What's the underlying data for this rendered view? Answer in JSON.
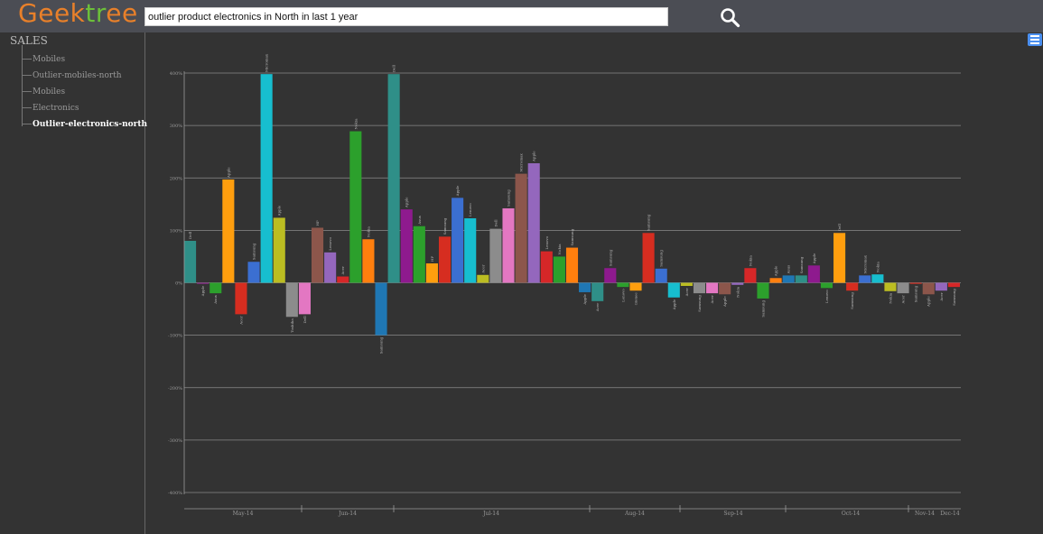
{
  "app": {
    "logo_letters": [
      {
        "ch": "G",
        "color": "#e8802a"
      },
      {
        "ch": "e",
        "color": "#e8802a"
      },
      {
        "ch": "e",
        "color": "#e8802a"
      },
      {
        "ch": "k",
        "color": "#e8802a"
      },
      {
        "ch": "t",
        "color": "#6cbf3a"
      },
      {
        "ch": "r",
        "color": "#6cbf3a"
      },
      {
        "ch": "e",
        "color": "#e8802a"
      },
      {
        "ch": "e",
        "color": "#e8802a"
      }
    ]
  },
  "search": {
    "query": "outlier product electronics in North in last 1 year",
    "button_icon": "search-icon"
  },
  "sidebar": {
    "title": "SALES",
    "items": [
      {
        "label": "Mobiles",
        "active": false
      },
      {
        "label": "Outlier-mobiles-north",
        "active": false
      },
      {
        "label": "Mobiles",
        "active": false
      },
      {
        "label": "Electronics",
        "active": false
      },
      {
        "label": "Outlier-electronics-north",
        "active": true
      }
    ]
  },
  "menu_icon": "hamburger-menu-icon",
  "chart_data": {
    "type": "bar",
    "ylim": [
      -400,
      400
    ],
    "yticks": [
      {
        "value": 400,
        "label": "400%"
      },
      {
        "value": 300,
        "label": "300%"
      },
      {
        "value": 200,
        "label": "200%"
      },
      {
        "value": 100,
        "label": "100%"
      },
      {
        "value": 0,
        "label": "0%"
      },
      {
        "value": -100,
        "label": "-100%"
      },
      {
        "value": -200,
        "label": "-200%"
      },
      {
        "value": -300,
        "label": "-300%"
      },
      {
        "value": -400,
        "label": "-400%"
      }
    ],
    "months": [
      "May-14",
      "Jun-14",
      "Jul-14",
      "Aug-14",
      "Sep-14",
      "Oct-14",
      "Nov-14",
      "Dec-14"
    ],
    "bars": [
      {
        "label": "Dell",
        "value": 80,
        "color": "#2f8f88"
      },
      {
        "label": "Apple",
        "value": -2,
        "color": "#8e2a8e"
      },
      {
        "label": "Asus",
        "value": -20,
        "color": "#2ca02c"
      },
      {
        "label": "Apple",
        "value": 197,
        "color": "#ff9e0e"
      },
      {
        "label": "Acer",
        "value": -60,
        "color": "#d62d20"
      },
      {
        "label": "Samsung",
        "value": 40,
        "color": "#3b6fd1"
      },
      {
        "label": "Micromax",
        "value": 398,
        "color": "#17becf"
      },
      {
        "label": "Apple",
        "value": 124,
        "color": "#bcbd22"
      },
      {
        "label": "Toshiba",
        "value": -65,
        "color": "#8c8c8c"
      },
      {
        "label": "Dell",
        "value": -60,
        "color": "#e377c2"
      },
      {
        "label": "HP",
        "value": 105,
        "color": "#8c564b"
      },
      {
        "label": "Lenovo",
        "value": 58,
        "color": "#9467bd"
      },
      {
        "label": "Acer",
        "value": 12,
        "color": "#d62728"
      },
      {
        "label": "Nokia",
        "value": 289,
        "color": "#2ca02c"
      },
      {
        "label": "Nokia",
        "value": 83,
        "color": "#ff7f0e"
      },
      {
        "label": "Samsung",
        "value": -100,
        "color": "#1f77b4"
      },
      {
        "label": "Dell",
        "value": 398,
        "color": "#2f8f88"
      },
      {
        "label": "Apple",
        "value": 140,
        "color": "#8e1a8e"
      },
      {
        "label": "Asus",
        "value": 108,
        "color": "#2ca02c"
      },
      {
        "label": "HP",
        "value": 37,
        "color": "#ff9e0e"
      },
      {
        "label": "Samsung",
        "value": 88,
        "color": "#d62d20"
      },
      {
        "label": "Apple",
        "value": 162,
        "color": "#3b6fd1"
      },
      {
        "label": "Lenovo",
        "value": 123,
        "color": "#17becf"
      },
      {
        "label": "Acer",
        "value": 15,
        "color": "#bcbd22"
      },
      {
        "label": "Dell",
        "value": 103,
        "color": "#8c8c8c"
      },
      {
        "label": "Samsung",
        "value": 142,
        "color": "#e377c2"
      },
      {
        "label": "Micromax",
        "value": 208,
        "color": "#8c564b"
      },
      {
        "label": "Apple",
        "value": 228,
        "color": "#9467bd"
      },
      {
        "label": "Lenovo",
        "value": 60,
        "color": "#d62728"
      },
      {
        "label": "Nokia",
        "value": 50,
        "color": "#2ca02c"
      },
      {
        "label": "Samsung",
        "value": 67,
        "color": "#ff7f0e"
      },
      {
        "label": "Apple",
        "value": -18,
        "color": "#1f77b4"
      },
      {
        "label": "Acer",
        "value": -35,
        "color": "#2f8f88"
      },
      {
        "label": "Samsung",
        "value": 28,
        "color": "#8e1a8e"
      },
      {
        "label": "Lenovo",
        "value": -8,
        "color": "#2ca02c"
      },
      {
        "label": "Gionee",
        "value": -15,
        "color": "#ff9e0e"
      },
      {
        "label": "Samsung",
        "value": 95,
        "color": "#d62d20"
      },
      {
        "label": "Samsung",
        "value": 27,
        "color": "#3b6fd1"
      },
      {
        "label": "Apple",
        "value": -28,
        "color": "#17becf"
      },
      {
        "label": "Acer",
        "value": -6,
        "color": "#bcbd22"
      },
      {
        "label": "Samsung",
        "value": -20,
        "color": "#8c8c8c"
      },
      {
        "label": "Acer",
        "value": -20,
        "color": "#e377c2"
      },
      {
        "label": "Apple",
        "value": -22,
        "color": "#8c564b"
      },
      {
        "label": "Nokia",
        "value": -4,
        "color": "#9467bd"
      },
      {
        "label": "Nokia",
        "value": 28,
        "color": "#d62728"
      },
      {
        "label": "Samsung",
        "value": -30,
        "color": "#2ca02c"
      },
      {
        "label": "Apple",
        "value": 9,
        "color": "#ff7f0e"
      },
      {
        "label": "Asus",
        "value": 14,
        "color": "#1f77b4"
      },
      {
        "label": "Samsung",
        "value": 14,
        "color": "#2f8f88"
      },
      {
        "label": "Apple",
        "value": 33,
        "color": "#8e1a8e"
      },
      {
        "label": "Lenovo",
        "value": -10,
        "color": "#2ca02c"
      },
      {
        "label": "Dell",
        "value": 95,
        "color": "#ff9e0e"
      },
      {
        "label": "Samsung",
        "value": -15,
        "color": "#d62d20"
      },
      {
        "label": "Micromax",
        "value": 14,
        "color": "#3b6fd1"
      },
      {
        "label": "Nokia",
        "value": 16,
        "color": "#17becf"
      },
      {
        "label": "Nokia",
        "value": -16,
        "color": "#bcbd22"
      },
      {
        "label": "Acer",
        "value": -20,
        "color": "#8c8c8c"
      },
      {
        "label": "Samsung",
        "value": -2,
        "color": "#d62d20"
      },
      {
        "label": "Apple",
        "value": -22,
        "color": "#8c564b"
      },
      {
        "label": "Acer",
        "value": -15,
        "color": "#9467bd"
      },
      {
        "label": "Samsung",
        "value": -8,
        "color": "#d62728"
      }
    ]
  }
}
